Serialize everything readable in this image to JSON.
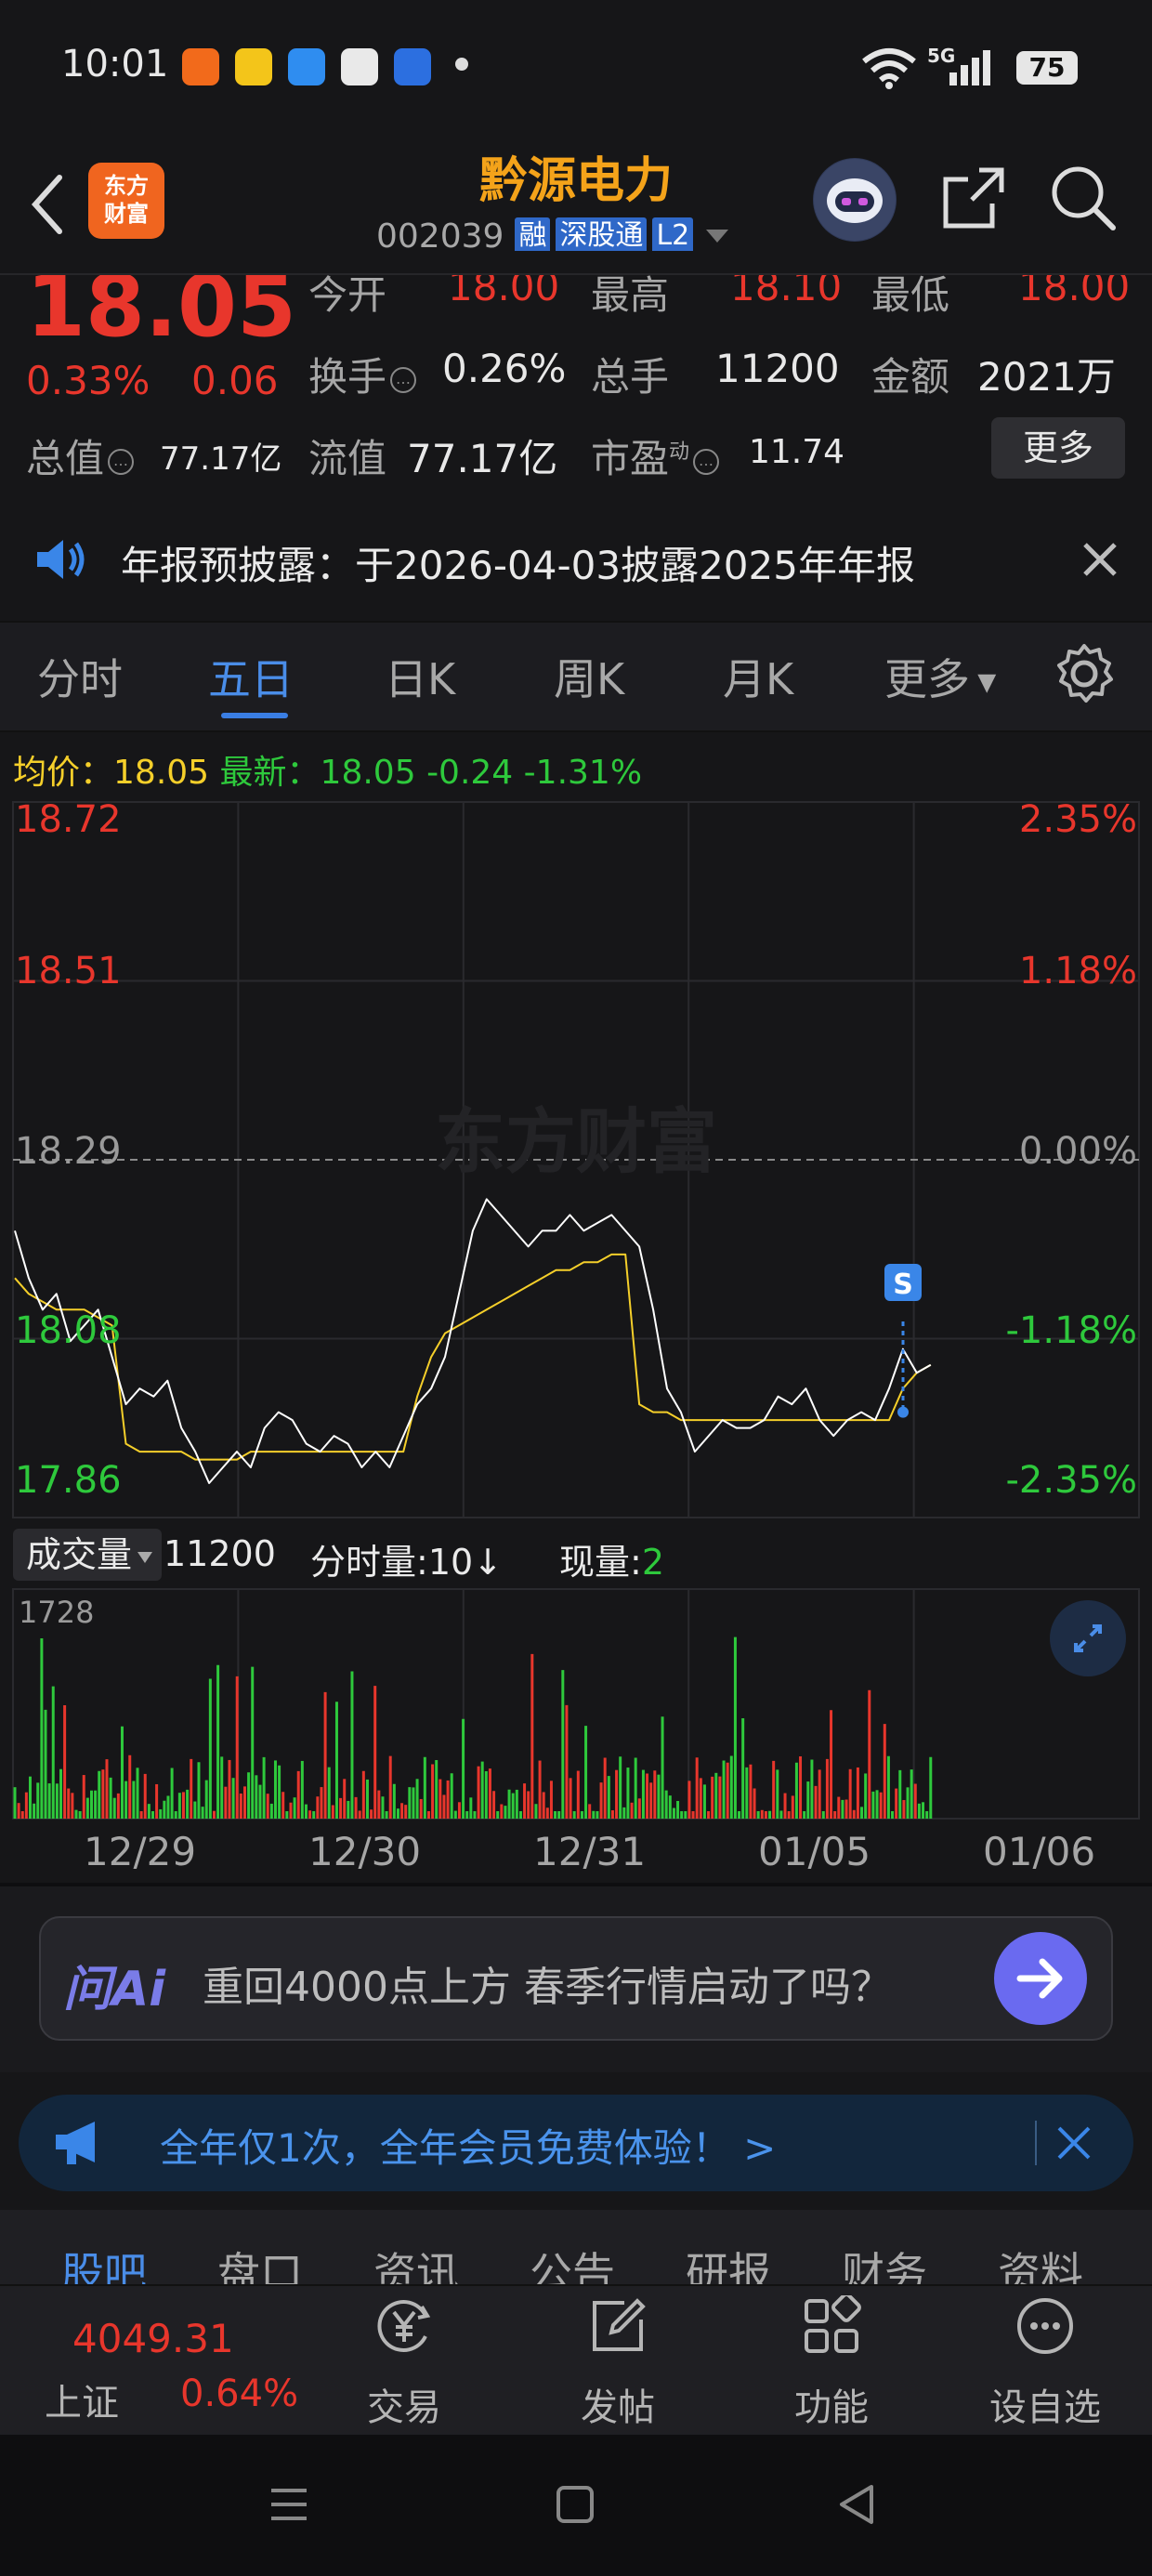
{
  "status_bar": {
    "time": "10:01",
    "network": "5G",
    "battery": "75"
  },
  "header": {
    "logo_line1": "东方",
    "logo_line2": "财富",
    "title": "黔源电力",
    "code": "002039",
    "tags": [
      "融",
      "深股通",
      "L2"
    ]
  },
  "quote": {
    "price": "18.05",
    "change_pct": "0.33%",
    "change": "0.06",
    "rows": [
      [
        {
          "label": "今开",
          "value": "18.00",
          "red": true
        },
        {
          "label": "最高",
          "value": "18.10",
          "red": true
        },
        {
          "label": "最低",
          "value": "18.00",
          "red": true
        }
      ],
      [
        {
          "label": "换手",
          "value": "0.26%"
        },
        {
          "label": "总手",
          "value": "11200"
        },
        {
          "label": "金额",
          "value": "2021万"
        }
      ]
    ],
    "market_cap_label": "总值",
    "market_cap": "77.17亿",
    "float_cap_label": "流值",
    "float_cap": "77.17亿",
    "pe_label": "市盈",
    "pe_sup": "动",
    "pe": "11.74",
    "more_label": "更多"
  },
  "notice": {
    "text": "年报预披露：于2026-04-03披露2025年年报"
  },
  "tabs": [
    "分时",
    "五日",
    "日K",
    "周K",
    "月K",
    "更多"
  ],
  "active_tab": "五日",
  "legend": {
    "avg_label": "均价：",
    "avg_value": "18.05",
    "latest_label": "最新：",
    "latest_value": "18.05",
    "latest_change": "-0.24",
    "latest_pct": "-1.31%"
  },
  "watermark": "东方财富",
  "chart_data": {
    "type": "line",
    "title": "",
    "y_labels_left": [
      "18.72",
      "18.51",
      "18.29",
      "18.08",
      "17.86"
    ],
    "y_labels_right": [
      "2.35%",
      "1.18%",
      "0.00%",
      "-1.18%",
      "-2.35%"
    ],
    "ylim": [
      17.86,
      18.72
    ],
    "prev_close": 18.29,
    "x_labels": [
      "12/29",
      "12/30",
      "12/31",
      "01/05",
      "01/06"
    ],
    "series": [
      {
        "name": "price",
        "color": "#ffffff",
        "values": [
          18.2,
          18.14,
          18.1,
          18.12,
          18.06,
          18.08,
          18.1,
          18.04,
          17.98,
          18.0,
          17.99,
          18.01,
          17.95,
          17.92,
          17.88,
          17.9,
          17.92,
          17.9,
          17.95,
          17.97,
          17.96,
          17.93,
          17.92,
          17.94,
          17.93,
          17.9,
          17.92,
          17.9,
          17.94,
          17.98,
          18.0,
          18.04,
          18.12,
          18.2,
          18.24,
          18.22,
          18.2,
          18.18,
          18.2,
          18.2,
          18.22,
          18.2,
          18.21,
          18.22,
          18.2,
          18.18,
          18.1,
          18.0,
          17.97,
          17.92,
          17.94,
          17.96,
          17.95,
          17.95,
          17.96,
          17.99,
          17.98,
          18.0,
          17.96,
          17.94,
          17.96,
          17.97,
          17.96,
          18.0,
          18.05,
          18.02,
          18.03
        ]
      },
      {
        "name": "avg",
        "color": "#f5cf2a",
        "values": [
          18.14,
          18.12,
          18.11,
          18.1,
          18.1,
          18.1,
          18.09,
          18.08,
          17.93,
          17.92,
          17.92,
          17.92,
          17.92,
          17.91,
          17.91,
          17.91,
          17.91,
          17.92,
          17.92,
          17.92,
          17.92,
          17.92,
          17.92,
          17.92,
          17.92,
          17.92,
          17.92,
          17.92,
          17.92,
          17.99,
          18.04,
          18.07,
          18.08,
          18.09,
          18.1,
          18.11,
          18.12,
          18.13,
          18.14,
          18.15,
          18.15,
          18.16,
          18.16,
          18.17,
          18.17,
          17.98,
          17.97,
          17.97,
          17.96,
          17.96,
          17.96,
          17.96,
          17.96,
          17.96,
          17.96,
          17.96,
          17.96,
          17.96,
          17.96,
          17.96,
          17.96,
          17.96,
          17.96,
          17.96,
          18.0,
          18.02,
          18.03
        ]
      }
    ],
    "marker": "S",
    "volume": {
      "label": "成交量",
      "total": "11200",
      "per_minute_label": "分时量:",
      "per_minute": "10",
      "per_minute_arrow": "↓",
      "current_label": "现量:",
      "current": "2",
      "max_label": "1728"
    }
  },
  "ai_bar": {
    "logo": "问Ai",
    "text": "重回4000点上方 春季行情启动了吗？"
  },
  "promo": {
    "text": "全年仅1次，全年会员免费体验！ >"
  },
  "sub_tabs": [
    "股吧",
    "盘口",
    "资讯",
    "公告",
    "研报",
    "财务",
    "资料"
  ],
  "active_sub_tab": "股吧",
  "bottom": {
    "index_value": "4049.31",
    "index_name": "上证",
    "index_pct": "0.64%",
    "buttons": [
      {
        "label": "交易",
        "icon": "yen-circle-icon"
      },
      {
        "label": "发帖",
        "icon": "edit-icon"
      },
      {
        "label": "功能",
        "icon": "grid-icon"
      },
      {
        "label": "设自选",
        "icon": "more-circle-icon"
      }
    ]
  },
  "colors": {
    "up": "#e8362c",
    "down": "#2ec93c",
    "accent": "#4a8de8",
    "avg_line": "#f5cf2a",
    "title": "#f4a31a"
  }
}
